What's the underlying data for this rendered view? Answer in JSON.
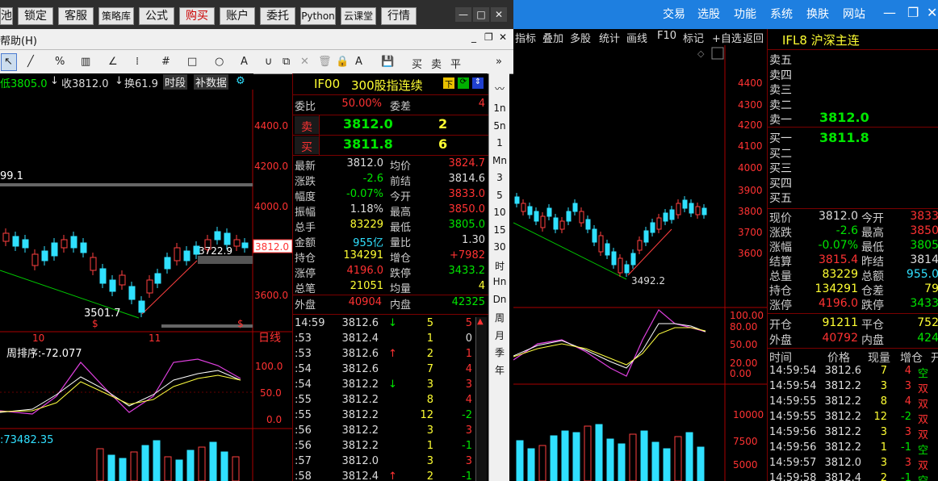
{
  "left_nav": {
    "items": [
      "池",
      "锁定",
      "客服",
      "策略库",
      "公式",
      "购买",
      "账户",
      "委托",
      "Python",
      "云课堂",
      "行情"
    ],
    "controls": [
      "—",
      "□",
      "✕"
    ]
  },
  "right_title": {
    "menu": [
      "交易",
      "选股",
      "功能",
      "系统",
      "换肤",
      "网站"
    ],
    "controls": [
      "—",
      "❐",
      "✕"
    ]
  },
  "left_menubar": {
    "help": "帮助(H)"
  },
  "left_toolbar": {
    "items": [
      "↖",
      "╱",
      "%",
      "▥",
      "∠",
      "⁞",
      "#",
      "□",
      "○",
      "A",
      "∪",
      "⧉",
      "✕",
      "🗑",
      "🔒",
      "A",
      "💾",
      "买",
      "卖",
      "平"
    ]
  },
  "left_chart": {
    "info": {
      "low": "低3805.0",
      "close": "收3812.0",
      "turnover": "换61.9",
      "period": "时段",
      "fill_data": "补数据"
    },
    "price_ticks": [
      "4400.0",
      "4200.0",
      "4000.0",
      "3800.0",
      "3600.0"
    ],
    "current_price_tag": "3812.0",
    "label_high": "99.1",
    "label_mid": "3722.9",
    "label_low": "3501.7",
    "date_labels": [
      "10",
      "11"
    ],
    "timeframe": "日线",
    "indicator_title": "周排序:-72.077",
    "indicator_ticks": [
      "100.0",
      "50.0",
      "0.0"
    ],
    "volume_title": ":73482.35"
  },
  "quote": {
    "code": "IF00",
    "name": "300股指连续",
    "weibi_label": "委比",
    "weibi_value": "50.00%",
    "weicha_label": "委差",
    "weicha_value": "4",
    "sell_label": "卖",
    "sell_price": "3812.0",
    "sell_qty": "2",
    "buy_label": "买",
    "buy_price": "3811.8",
    "buy_qty": "6",
    "rows": [
      {
        "k1": "最新",
        "v1": "3812.0",
        "c1": "white",
        "k2": "均价",
        "v2": "3824.7",
        "c2": "red"
      },
      {
        "k1": "涨跌",
        "v1": "-2.6",
        "c1": "green",
        "k2": "前结",
        "v2": "3814.6",
        "c2": "white"
      },
      {
        "k1": "幅度",
        "v1": "-0.07%",
        "c1": "green",
        "k2": "今开",
        "v2": "3833.0",
        "c2": "red"
      },
      {
        "k1": "振幅",
        "v1": "1.18%",
        "c1": "white",
        "k2": "最高",
        "v2": "3850.0",
        "c2": "red"
      },
      {
        "k1": "总手",
        "v1": "83229",
        "c1": "yellow",
        "k2": "最低",
        "v2": "3805.0",
        "c2": "green"
      },
      {
        "k1": "金额",
        "v1": "955亿",
        "c1": "cyan",
        "k2": "量比",
        "v2": "1.30",
        "c2": "white"
      },
      {
        "k1": "持仓",
        "v1": "134291",
        "c1": "yellow",
        "k2": "增仓",
        "v2": "+7982",
        "c2": "red"
      },
      {
        "k1": "涨停",
        "v1": "4196.0",
        "c1": "red",
        "k2": "跌停",
        "v2": "3433.2",
        "c2": "green"
      },
      {
        "k1": "总笔",
        "v1": "21051",
        "c1": "yellow",
        "k2": "均量",
        "v2": "4",
        "c2": "yellow"
      }
    ],
    "outer_label": "外盘",
    "outer_value": "40904",
    "inner_label": "内盘",
    "inner_value": "42325",
    "ticks": [
      {
        "t": "14:59",
        "p": "3812.6",
        "a": "↓",
        "ac": "green",
        "q": "5",
        "d": "5",
        "dc": "red"
      },
      {
        "t": ":53",
        "p": "3812.4",
        "a": "",
        "ac": "",
        "q": "1",
        "d": "0",
        "dc": "white"
      },
      {
        "t": ":53",
        "p": "3812.6",
        "a": "↑",
        "ac": "red",
        "q": "2",
        "d": "1",
        "dc": "red"
      },
      {
        "t": ":54",
        "p": "3812.6",
        "a": "",
        "ac": "",
        "q": "7",
        "d": "4",
        "dc": "red"
      },
      {
        "t": ":54",
        "p": "3812.2",
        "a": "↓",
        "ac": "green",
        "q": "3",
        "d": "3",
        "dc": "red"
      },
      {
        "t": ":55",
        "p": "3812.2",
        "a": "",
        "ac": "",
        "q": "8",
        "d": "4",
        "dc": "red"
      },
      {
        "t": ":55",
        "p": "3812.2",
        "a": "",
        "ac": "",
        "q": "12",
        "d": "-2",
        "dc": "green"
      },
      {
        "t": ":56",
        "p": "3812.2",
        "a": "",
        "ac": "",
        "q": "3",
        "d": "3",
        "dc": "red"
      },
      {
        "t": ":56",
        "p": "3812.2",
        "a": "",
        "ac": "",
        "q": "1",
        "d": "-1",
        "dc": "green"
      },
      {
        "t": ":57",
        "p": "3812.0",
        "a": "",
        "ac": "",
        "q": "3",
        "d": "3",
        "dc": "red"
      },
      {
        "t": ":58",
        "p": "3812.4",
        "a": "↑",
        "ac": "red",
        "q": "2",
        "d": "-1",
        "dc": "green"
      }
    ]
  },
  "period_bar": [
    "1n",
    "5n",
    "1",
    "Mn",
    "3",
    "5",
    "10",
    "15",
    "30",
    "时",
    "Hn",
    "Dn",
    "周",
    "月",
    "季",
    "年"
  ],
  "right_toolbar": [
    "指标",
    "叠加",
    "多股",
    "统计",
    "画线",
    "F10",
    "标记",
    "+自选",
    "返回"
  ],
  "right_chart": {
    "price_ticks": [
      "4400",
      "4300",
      "4200",
      "4100",
      "4000",
      "3900",
      "3800",
      "3700",
      "3600"
    ],
    "low_label": "3492.2",
    "ind_ticks": [
      "100.00",
      "80.00",
      "50.00",
      "20.00",
      "0.00"
    ],
    "vol_ticks": [
      "10000",
      "7500",
      "5000"
    ]
  },
  "right_quote": {
    "title": "IFL8 沪深主连",
    "asks": [
      "卖五",
      "卖四",
      "卖三",
      "卖二",
      "卖一"
    ],
    "ask1_price": "3812.0",
    "bids": [
      "买一",
      "买二",
      "买三",
      "买四",
      "买五"
    ],
    "bid1_price": "3811.8",
    "stats": [
      {
        "k1": "现价",
        "v1": "3812.0",
        "c1": "white",
        "k2": "今开",
        "v2": "3833",
        "c2": "red"
      },
      {
        "k1": "涨跌",
        "v1": "-2.6",
        "c1": "green",
        "k2": "最高",
        "v2": "3850",
        "c2": "red"
      },
      {
        "k1": "涨幅",
        "v1": "-0.07%",
        "c1": "green",
        "k2": "最低",
        "v2": "3805",
        "c2": "green"
      },
      {
        "k1": "结算",
        "v1": "3815.4",
        "c1": "red",
        "k2": "昨结",
        "v2": "3814",
        "c2": "white"
      },
      {
        "k1": "总量",
        "v1": "83229",
        "c1": "yellow",
        "k2": "总额",
        "v2": "955.0",
        "c2": "cyan"
      },
      {
        "k1": "持仓",
        "v1": "134291",
        "c1": "yellow",
        "k2": "仓差",
        "v2": "79",
        "c2": "yellow"
      },
      {
        "k1": "涨停",
        "v1": "4196.0",
        "c1": "red",
        "k2": "跌停",
        "v2": "3433",
        "c2": "green"
      }
    ],
    "open_pos_label": "开仓",
    "open_pos_value": "91211",
    "close_pos_label": "平仓",
    "close_pos_value": "752",
    "outer_label": "外盘",
    "outer_value": "40792",
    "inner_label": "内盘",
    "inner_value": "424",
    "tick_headers": [
      "时间",
      "价格",
      "现量",
      "增仓",
      "开"
    ],
    "ticks": [
      {
        "t": "14:59:54",
        "p": "3812.6",
        "q": "7",
        "d": "4",
        "dc": "red",
        "x": "空"
      },
      {
        "t": "14:59:54",
        "p": "3812.2",
        "q": "3",
        "d": "3",
        "dc": "red",
        "x": "双"
      },
      {
        "t": "14:59:55",
        "p": "3812.2",
        "q": "8",
        "d": "4",
        "dc": "red",
        "x": "双"
      },
      {
        "t": "14:59:55",
        "p": "3812.2",
        "q": "12",
        "d": "-2",
        "dc": "green",
        "x": "双"
      },
      {
        "t": "14:59:56",
        "p": "3812.2",
        "q": "3",
        "d": "3",
        "dc": "red",
        "x": "双"
      },
      {
        "t": "14:59:56",
        "p": "3812.2",
        "q": "1",
        "d": "-1",
        "dc": "green",
        "x": "空"
      },
      {
        "t": "14:59:57",
        "p": "3812.0",
        "q": "3",
        "d": "3",
        "dc": "red",
        "x": "双"
      },
      {
        "t": "14:59:58",
        "p": "3812.4",
        "q": "2",
        "d": "-1",
        "dc": "green",
        "x": "空"
      }
    ]
  }
}
